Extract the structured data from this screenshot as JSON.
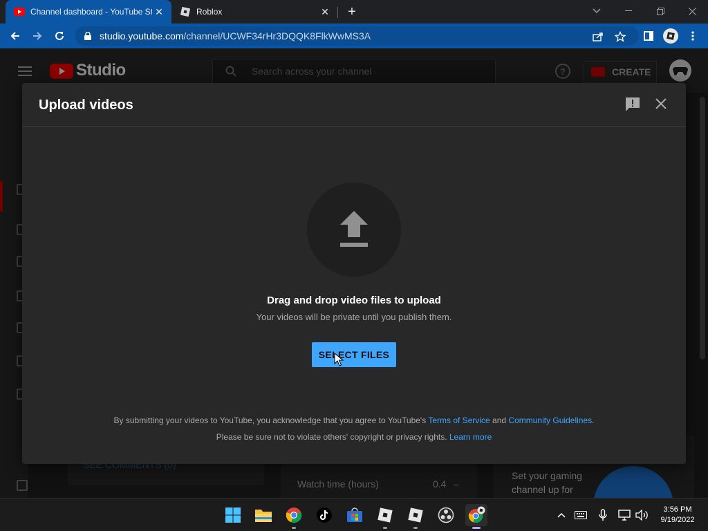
{
  "browser": {
    "tabs": [
      {
        "title": "Channel dashboard - YouTube St",
        "active": true,
        "favicon": "youtube-icon"
      },
      {
        "title": "Roblox",
        "active": false,
        "favicon": "roblox-icon"
      }
    ],
    "url_host": "studio.youtube.com",
    "url_path": "/channel/UCWF34rHr3DQQK8FlkWwMS3A",
    "accent_color": "#0b57a6"
  },
  "studio": {
    "logo_text": "Studio",
    "search_placeholder": "Search across your channel",
    "create_label": "CREATE",
    "background_text": {
      "see_comments": "SEE COMMENTS (0)",
      "watch_time_label": "Watch time (hours)",
      "watch_time_value": "0.4",
      "watch_time_dash": "–",
      "gaming_line1": "Set your gaming",
      "gaming_line2": "channel up for"
    }
  },
  "dialog": {
    "title": "Upload videos",
    "drag_title": "Drag and drop video files to upload",
    "drag_subtitle": "Your videos will be private until you publish them.",
    "select_button": "SELECT FILES",
    "legal_line1_prefix": "By submitting your videos to YouTube, you acknowledge that you agree to YouTube's ",
    "terms_link": "Terms of Service",
    "legal_and": " and ",
    "guidelines_link": "Community Guidelines",
    "legal_period": ".",
    "legal_line2_prefix": "Please be sure not to violate others' copyright or privacy rights. ",
    "learn_more_link": "Learn more",
    "button_color": "#3ea6ff"
  },
  "taskbar": {
    "apps": [
      "windows-start-icon",
      "file-explorer-icon",
      "chrome-icon",
      "tiktok-icon",
      "microsoft-store-icon",
      "roblox-icon",
      "roblox-studio-icon",
      "obs-icon",
      "chrome-roblox-icon"
    ],
    "time": "3:56 PM",
    "date": "9/19/2022"
  }
}
